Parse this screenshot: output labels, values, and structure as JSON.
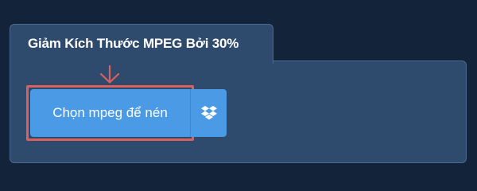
{
  "converter": {
    "title": "Giảm Kích Thước MPEG Bởi 30%",
    "upload_label": "Chọn mpeg để nén",
    "dropbox_icon": "dropbox-icon",
    "arrow_icon": "arrow-down-icon"
  },
  "colors": {
    "background": "#13233a",
    "panel": "#2e4a6d",
    "button": "#4a9ae6",
    "highlight": "#d9605c"
  }
}
